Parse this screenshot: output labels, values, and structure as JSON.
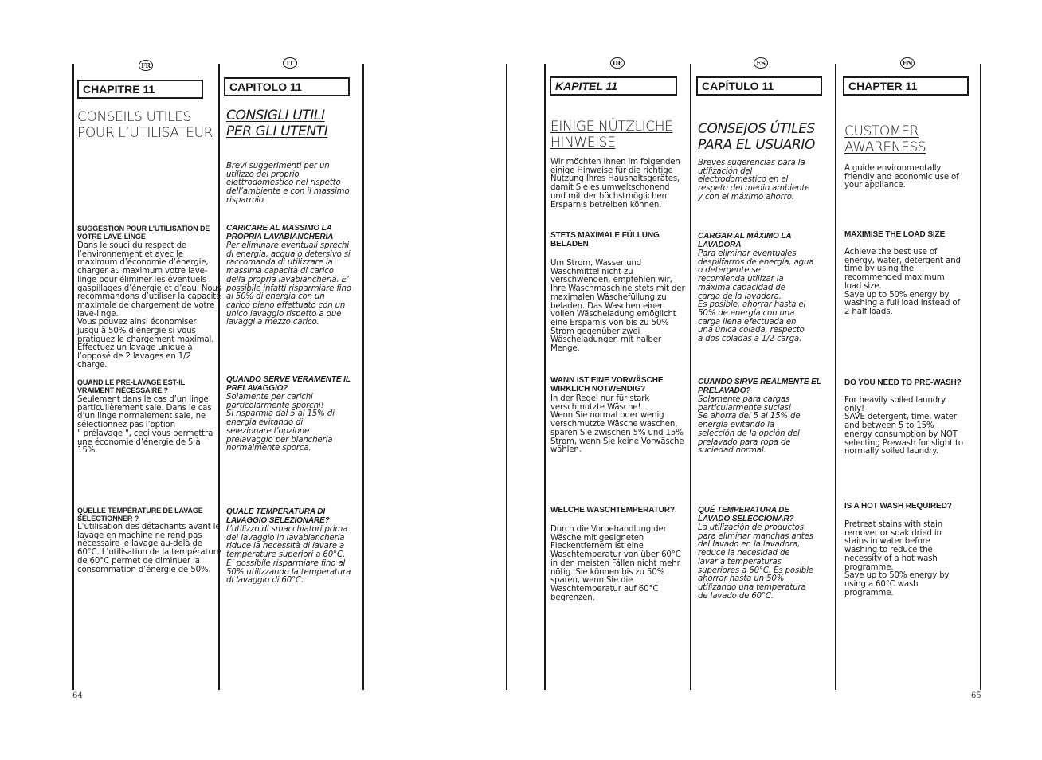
{
  "page_numbers": {
    "left": "64",
    "right": "65"
  },
  "columns": [
    {
      "lang": "FR",
      "chapter": "CHAPITRE 11",
      "title": "CONSEILS UTILES\nPOUR L’UTILISATEUR",
      "intro": "",
      "sections": [
        {
          "heading": "SUGGESTION POUR L'UTILISATION DE\nVOTRE LAVE-LINGE",
          "body": "Dans le souci du respect de\nl’environnement et avec le\nmaximum d’économie d’énergie,\ncharger au maximum votre lave-\nlinge pour éliminer les éventuels\ngaspillages d’énergie et d’eau. Nous\nrecommandons d’utiliser la capacité\nmaximale de chargement de votre\nlave-linge.\n Vous pouvez ainsi économiser\njusqu’à 50% d’énergie si vous\npratiquez le chargement maximal.\nEffectuez un lavage unique à\nl’opposé de 2 lavages en 1/2\ncharge."
        },
        {
          "heading": "QUAND LE PRE-LAVAGE EST-IL\nVRAIMENT NÉCESSAIRE ?",
          "body": "Seulement dans le cas d’un linge\nparticulièrement sale. Dans le cas\nd’un linge normalement sale, ne\nsélectionnez pas l’option\n\" prélavage \", ceci vous permettra\nune économie d’énergie de 5 à\n15%."
        },
        {
          "heading": "QUELLE TEMPÉRATURE DE LAVAGE\nSÉLECTIONNER ?",
          "body": "L’utilisation des détachants avant le\nlavage en machine ne rend pas\nnécessaire le lavage au-delà de\n60°C. L’utilisation de la température\nde 60°C permet de diminuer la\nconsommation d’énergie de 50%."
        }
      ]
    },
    {
      "lang": "IT",
      "chapter": "CAPITOLO 11",
      "title": "CONSIGLI UTILI\nPER GLI UTENTI",
      "intro": "Brevi suggerimenti per un\nutilizzo del proprio\nelettrodomestico nel rispetto\ndell’ambiente e con il massimo\nrisparmio",
      "sections": [
        {
          "heading": "CARICARE AL MASSIMO LA\nPROPRIA LAVABIANCHERIA",
          "body": "Per eliminare eventuali sprechi\ndi energia, acqua o detersivo si\nraccomanda di utilizzare la\nmassima capacità di carico\ndella propria lavabiancheria. E’\npossibile infatti risparmiare fino\nal 50% di energia con un\ncarico pieno effettuato con un\nunico lavaggio rispetto a due\nlavaggi a mezzo carico."
        },
        {
          "heading": "QUANDO SERVE VERAMENTE IL\nPRELAVAGGIO?",
          "body": "Solamente per carichi\nparticolarmente sporchi!\nSi risparmia dal 5 al 15% di\nenergia evitando di\nselezionare l’opzione\nprelavaggio per biancheria\nnormalmente sporca."
        },
        {
          "heading": "QUALE TEMPERATURA DI\nLAVAGGIO SELEZIONARE?",
          "body": "L’utilizzo di smacchiatori prima\ndel lavaggio in lavabiancheria\nriduce la necessità di lavare a\ntemperature superiori a 60°C.\nE’ possibile risparmiare fino al\n50% utilizzando la temperatura\ndi lavaggio di 60°C."
        }
      ]
    },
    {
      "lang": "DE",
      "chapter": "KAPITEL 11",
      "title": "EINIGE NÜTZLICHE\nHINWEISE",
      "intro": "Wir möchten Ihnen im folgenden\neinige Hinweise für die richtige\nNutzung Ihres Haushaltsgerätes,\ndamit Sie es umweltschonend\nund mit der höchstmöglichen\nErsparnis betreiben können.",
      "sections": [
        {
          "heading": "STETS MAXIMALE FÜLLUNG\nBELADEN",
          "body": "Um Strom, Wasser und\nWaschmittel nicht zu\nverschwenden, empfehlen wir,\nIhre Waschmaschine stets mit der\nmaximalen Wäschefüllung zu\nbeladen. Das Waschen einer\nvollen Wäscheladung emöglicht\neine Ersparnis von bis zu 50%\nStrom gegenüber zwei\nWäscheladungen mit halber\nMenge."
        },
        {
          "heading": "WANN IST EINE VORWÄSCHE\nWIRKLICH NOTWENDIG?",
          "body": "In der Regel nur für stark\nverschmutzte Wäsche!\nWenn Sie normal oder wenig\nverschmutzte Wäsche waschen,\nsparen Sie zwischen 5% und 15%\nStrom, wenn Sie keine Vorwäsche\nwählen."
        },
        {
          "heading": "WELCHE WASCHTEMPERATUR?",
          "body": "Durch die Vorbehandlung der\nWäsche mit geeigneten\nFleckentfernern ist eine\nWaschtemperatur von über 60°C\nin den meisten Fällen nicht mehr\nnötig. Sie können bis zu 50%\nsparen, wenn Sie die\nWaschtemperatur auf 60°C\nbegrenzen."
        }
      ]
    },
    {
      "lang": "ES",
      "chapter": "CAPÍTULO 11",
      "title": "CONSEJOS ÚTILES\nPARA EL USUARIO",
      "intro": "Breves sugerencias para la\nutilización del\nelectrodoméstico en el\nrespeto del medio ambiente\ny con el máximo ahorro.",
      "sections": [
        {
          "heading": "CARGAR AL MÁXIMO LA\nLAVADORA",
          "body": "Para eliminar eventuales\ndespilfarros de energía, agua\no detergente  se\nrecomienda utilizar la\nmáxima capacidad de\ncarga de la lavadora.\nEs posible, ahorrar hasta el\n50% de energía con una\ncarga llena efectuada en\nuna única colada, respecto\na dos coladas a 1/2 carga."
        },
        {
          "heading": "CUANDO SIRVE REALMENTE EL\nPRELAVADO?",
          "body": "Solamente para cargas\nparticularmente sucias!\nSe ahorra del 5 al 15% de\nenergía evitando la\nselección de la opción del\nprelavado para ropa de\nsuciedad normal."
        },
        {
          "heading": "QUÉ TEMPERATURA DE\nLAVADO SELECCIONAR?",
          "body": "La utilización de productos\npara eliminar manchas antes\ndel lavado en la lavadora,\nreduce la necesidad de\nlavar a temperaturas\nsuperiores a 60°C. Es posible\nahorrar hasta un 50%\nutilizando una temperatura\nde lavado de 60°C."
        }
      ]
    },
    {
      "lang": "EN",
      "chapter": "CHAPTER 11",
      "title": "CUSTOMER\nAWARENESS",
      "intro": "A guide environmentally\nfriendly and economic use of\nyour appliance.",
      "sections": [
        {
          "heading": "MAXIMISE THE LOAD SIZE",
          "body": "Achieve the best use of\nenergy, water, detergent and\ntime by using the\nrecommended maximum\nload size.\nSave up to 50% energy by\nwashing a full load instead of\n2 half loads."
        },
        {
          "heading": "DO YOU NEED TO PRE-WASH?",
          "body": "For heavily soiled laundry\nonly!\nSAVE detergent, time, water\nand between 5 to 15%\nenergy consumption by NOT\nselecting Prewash for slight to\nnormally soiled laundry."
        },
        {
          "heading": "IS A HOT WASH REQUIRED?",
          "body": "Pretreat stains with stain\nremover or soak dried in\nstains in water before\nwashing to reduce the\nnecessity of a hot wash\nprogramme.\nSave up to 50% energy by\nusing a 60°C wash\nprogramme."
        }
      ]
    }
  ]
}
